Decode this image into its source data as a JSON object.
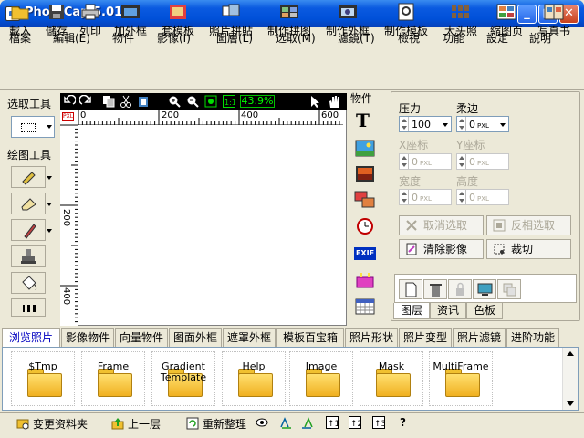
{
  "window": {
    "title": "PhotoCap 5.01",
    "minimize": "_",
    "maximize": "□",
    "close": "✕"
  },
  "menu": [
    "檔案",
    "編輯(E)",
    "物件",
    "影像(I)",
    "圖層(L)",
    "选取(M)",
    "濾鏡(T)",
    "檢視",
    "功能",
    "設定",
    "說明"
  ],
  "toolbar": [
    "載入",
    "儲存",
    "列印",
    "加外框",
    "套模板",
    "照片拼貼",
    "制作拼图",
    "制作外框",
    "制作模板",
    "大头照",
    "縮图页",
    "写真书"
  ],
  "left_panel": {
    "select_label": "选取工具",
    "draw_label": "绘图工具"
  },
  "canvas": {
    "zoom": "43.9%",
    "unit": "PXL",
    "ruler_top": [
      "0",
      "200",
      "400",
      "600"
    ],
    "ruler_left": [
      "200",
      "400"
    ]
  },
  "objects_panel": {
    "title": "物件",
    "text_tool": "T",
    "exif": "EXIF"
  },
  "properties": {
    "pressure_label": "压力",
    "pressure_value": "100",
    "soft_label": "柔边",
    "soft_value": "0",
    "x_label": "X座标",
    "x_value": "0",
    "y_label": "Y座标",
    "y_value": "0",
    "width_label": "宽度",
    "width_value": "0",
    "height_label": "高度",
    "height_value": "0",
    "unit": "PXL",
    "cancel_select": "取消选取",
    "invert_select": "反相选取",
    "clear_image": "清除影像",
    "crop": "裁切"
  },
  "right_tabs": [
    "图层",
    "资讯",
    "色板"
  ],
  "bottom_tabs": [
    "浏览照片",
    "影像物件",
    "向量物件",
    "图面外框",
    "遮罩外框",
    "模板百宝箱",
    "照片形状",
    "照片变型",
    "照片滤镜",
    "进阶功能"
  ],
  "folders": [
    "$Tmp",
    "Frame",
    "Gradient\nTemplate",
    "Help",
    "Image",
    "Mask",
    "MultiFrame"
  ],
  "status_bar": {
    "change_folder": "变更资料夹",
    "up_level": "上一层",
    "refresh": "重新整理",
    "help": "?"
  },
  "colors": {
    "title_bar": "#0a5ae0",
    "zoom_text": "#00ff00",
    "active_tab_text": "#0000c0"
  }
}
